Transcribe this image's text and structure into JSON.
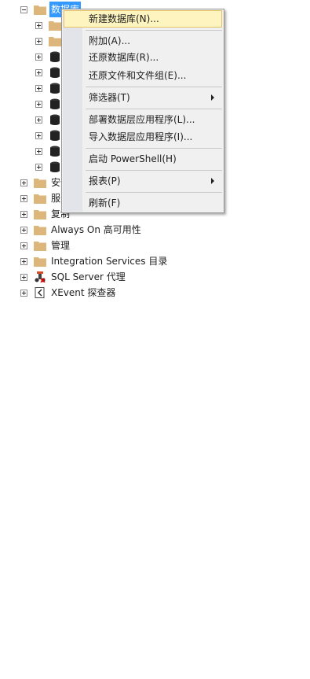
{
  "tree": {
    "databases_label": "数据库",
    "items": [
      {
        "label": "安全性"
      },
      {
        "label": "服务器对象"
      },
      {
        "label": "复制"
      },
      {
        "label": "Always On 高可用性"
      },
      {
        "label": "管理"
      },
      {
        "label": "Integration Services 目录"
      },
      {
        "label": "SQL Server 代理"
      },
      {
        "label": "XEvent 探查器"
      }
    ]
  },
  "context_menu": {
    "new_database": "新建数据库(N)...",
    "attach": "附加(A)...",
    "restore_database": "还原数据库(R)...",
    "restore_files": "还原文件和文件组(E)...",
    "filter": "筛选器(T)",
    "deploy_dac": "部署数据层应用程序(L)...",
    "import_dac": "导入数据层应用程序(I)...",
    "start_powershell": "启动 PowerShell(H)",
    "reports": "报表(P)",
    "refresh": "刷新(F)"
  },
  "colors": {
    "folder": "#dcb67a",
    "selection": "#3399ff",
    "menu_highlight": "#fdf4bf",
    "menu_highlight_border": "#e5c365"
  }
}
